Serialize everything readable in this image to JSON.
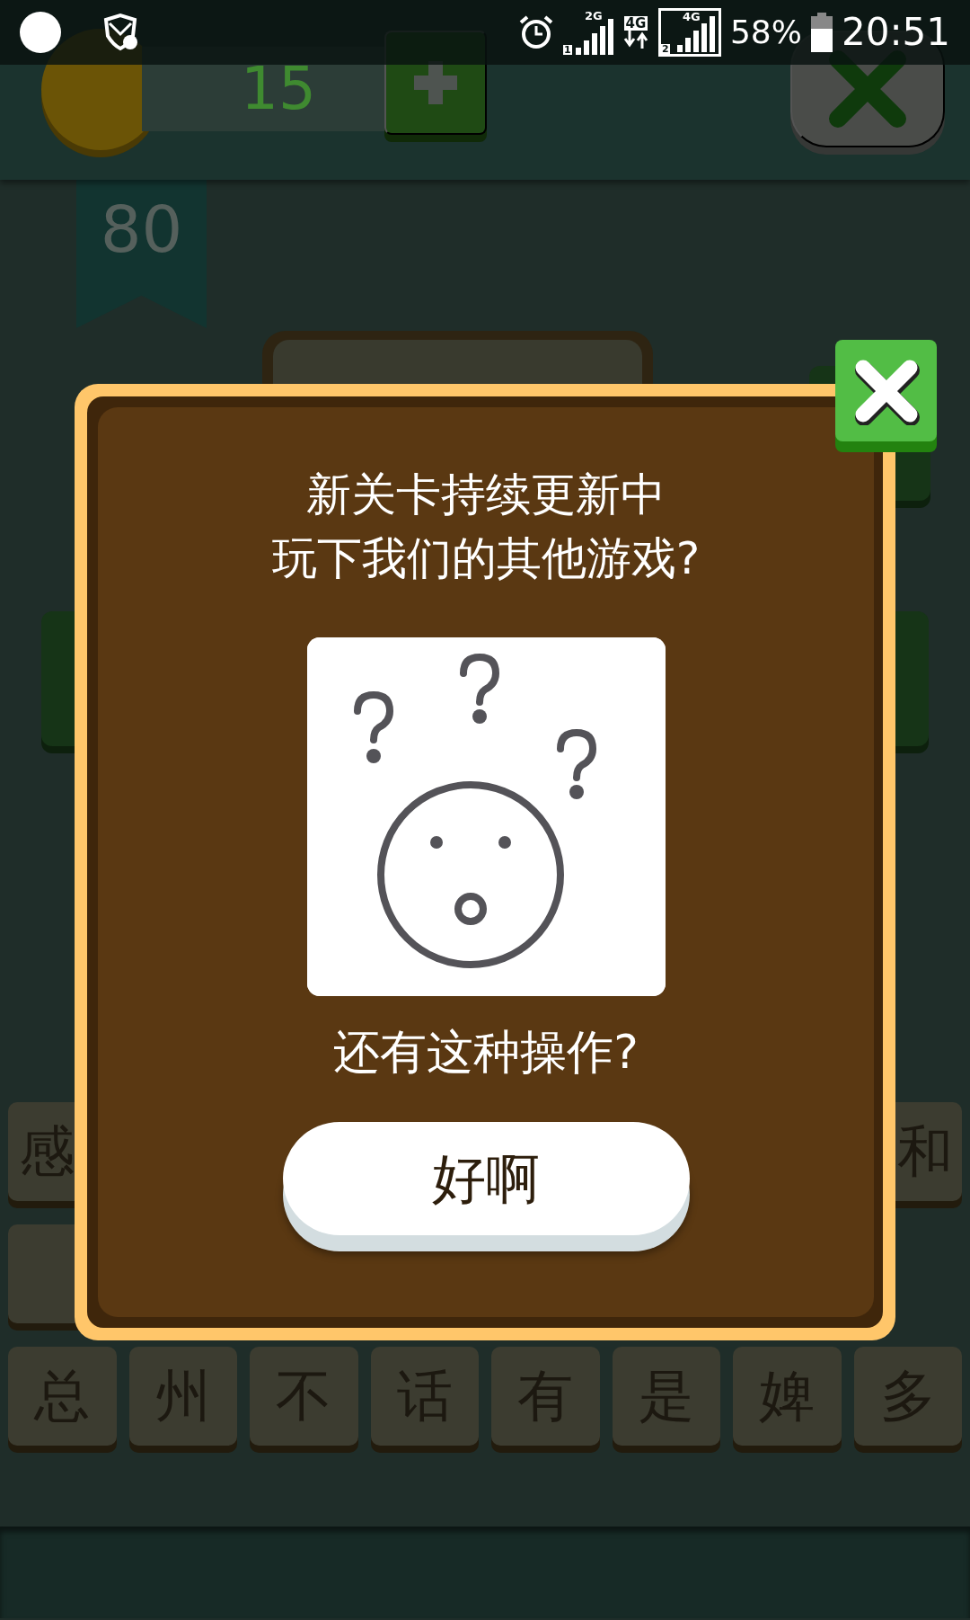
{
  "status_bar": {
    "signal_1": {
      "network": "2G",
      "sim": "1"
    },
    "data_network": "4G",
    "signal_2": {
      "network": "4G",
      "sim": "2"
    },
    "battery": "58%",
    "time": "20:51"
  },
  "header": {
    "coins": "15"
  },
  "level": "80",
  "tile_rows": [
    {
      "tiles": [
        {
          "kind": "letter",
          "text": "感"
        },
        {
          "kind": "letter",
          "text": "和"
        }
      ]
    },
    {
      "tiles": [
        {
          "kind": "covered"
        }
      ]
    },
    {
      "tiles": [
        {
          "kind": "letter",
          "text": "总"
        },
        {
          "kind": "letter",
          "text": "州"
        },
        {
          "kind": "letter",
          "text": "不"
        },
        {
          "kind": "letter",
          "text": "话"
        },
        {
          "kind": "letter",
          "text": "有"
        },
        {
          "kind": "letter",
          "text": "是"
        },
        {
          "kind": "letter",
          "text": "婢"
        },
        {
          "kind": "letter",
          "text": "多"
        }
      ]
    }
  ],
  "dialog": {
    "message_lines": [
      "新关卡持续更新中",
      "玩下我们的其他游戏?"
    ],
    "caption": "还有这种操作?",
    "confirm_button": "好啊"
  }
}
